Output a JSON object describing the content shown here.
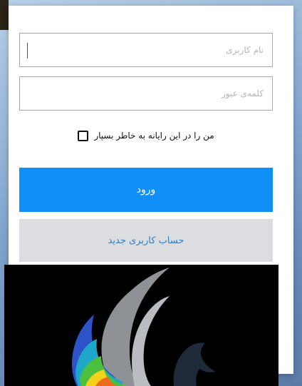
{
  "login_form": {
    "username_placeholder": "نام کاربری",
    "password_placeholder": "کلمه‌ی عبور",
    "remember_me_label": "من را در این رایانه به خاطر بسپار",
    "login_button_label": "ورود",
    "register_button_label": "حساب کاربری جدید"
  },
  "colors": {
    "login_button": "#0f8ff7",
    "register_button": "#dcdde0",
    "register_text": "#2e7fc4"
  },
  "logo": {
    "icon": "app-logo-icon"
  }
}
